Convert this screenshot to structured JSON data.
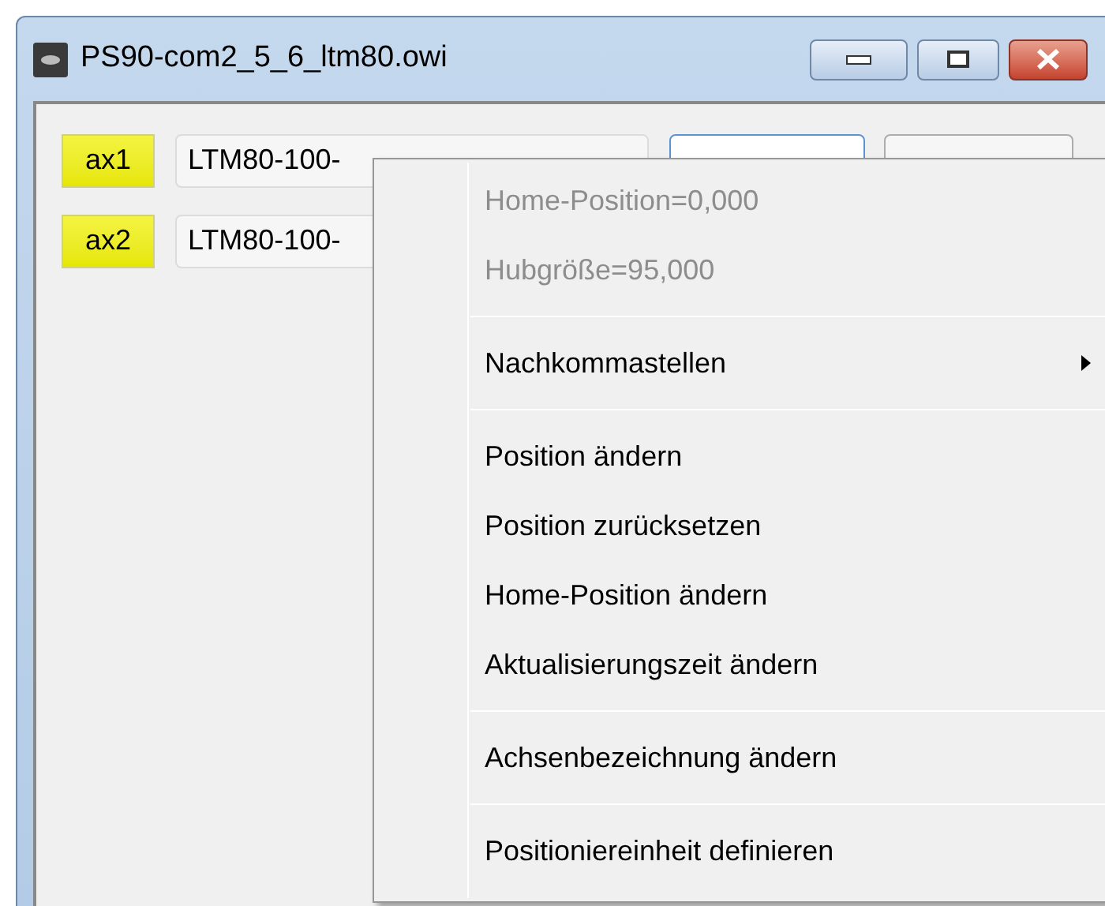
{
  "window": {
    "title": "PS90-com2_5_6_ltm80.owi"
  },
  "axes": [
    {
      "label": "ax1",
      "name": "LTM80-100-"
    },
    {
      "label": "ax2",
      "name": "LTM80-100-"
    }
  ],
  "context_menu": [
    {
      "kind": "item",
      "label": "Home-Position=0,000",
      "disabled": true
    },
    {
      "kind": "item",
      "label": "Hubgröße=95,000",
      "disabled": true
    },
    {
      "kind": "separator"
    },
    {
      "kind": "submenu",
      "label": "Nachkommastellen",
      "disabled": false
    },
    {
      "kind": "separator"
    },
    {
      "kind": "item",
      "label": "Position ändern",
      "disabled": false
    },
    {
      "kind": "item",
      "label": "Position zurücksetzen",
      "disabled": false
    },
    {
      "kind": "item",
      "label": "Home-Position ändern",
      "disabled": false
    },
    {
      "kind": "item",
      "label": "Aktualisierungszeit ändern",
      "disabled": false
    },
    {
      "kind": "separator"
    },
    {
      "kind": "item",
      "label": "Achsenbezeichnung ändern",
      "disabled": false
    },
    {
      "kind": "separator"
    },
    {
      "kind": "item",
      "label": "Positioniereinheit definieren",
      "disabled": false
    }
  ]
}
